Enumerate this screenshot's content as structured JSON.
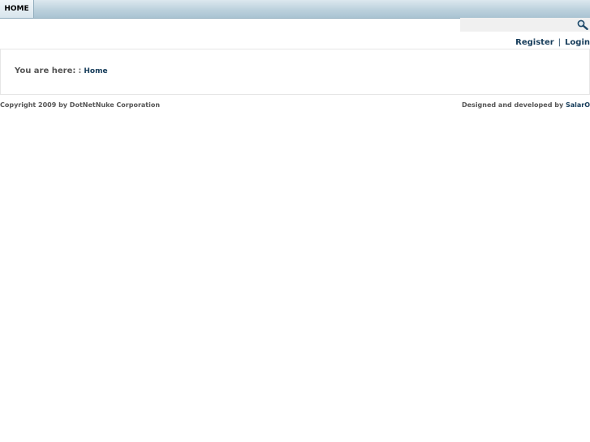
{
  "nav": {
    "home_label": "HOME"
  },
  "search": {
    "value": "",
    "placeholder": "",
    "icon": "magnifier-icon"
  },
  "user_links": {
    "register": "Register",
    "separator": "|",
    "login": "Login"
  },
  "breadcrumb": {
    "label": "You are here:",
    "separator": ":",
    "home": "Home"
  },
  "footer": {
    "copyright": "Copyright 2009 by DotNetNuke Corporation",
    "credit_prefix": "Designed and developed by",
    "credit_link": "SalarO"
  },
  "colors": {
    "link": "#163c5a",
    "nav_bar": "#bcd1dd",
    "text": "#555555"
  }
}
